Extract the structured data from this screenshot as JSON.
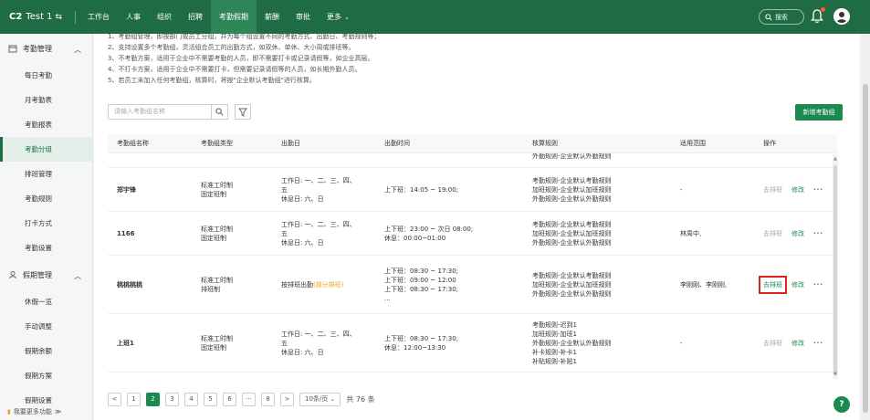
{
  "topbar": {
    "logo": "C2",
    "company": "Test 1",
    "nav": [
      "工作台",
      "人事",
      "组织",
      "招聘",
      "考勤假期",
      "薪酬",
      "审批",
      "更多"
    ],
    "search_placeholder": "搜索"
  },
  "sidebar": {
    "groups": [
      {
        "label": "考勤管理",
        "items": [
          "每日考勤",
          "月考勤表",
          "考勤报表",
          "考勤分组",
          "排班管理",
          "考勤规则",
          "打卡方式",
          "考勤设置"
        ]
      },
      {
        "label": "假期管理",
        "items": [
          "休假一览",
          "手动调整",
          "假期余额",
          "假期方案",
          "假期设置"
        ]
      }
    ],
    "active_item": "考勤分组",
    "footer": "我要更多功能"
  },
  "notes": [
    "1、考勤组管理，即按部门或员工分组，并为每个组设置不同的考勤方式、出勤日、考勤规则等；",
    "2、支持设置多个考勤组，灵活组合员工的出勤方式，如双休、单休、大小周或排班等。",
    "3、不考勤方案，适用于企业中不需要考勤的人员，即不需要打卡或记录请假等，如企业高层。",
    "4、不打卡方案，适用于企业中不需要打卡，但需要记录请假等的人员，如长期外勤人员。",
    "5、若员工未加入任何考勤组，核算时，将按\"企业默认考勤组\"进行核算。"
  ],
  "toolbar": {
    "search_placeholder": "请输入考勤组名称",
    "add_button": "新增考勤组"
  },
  "table": {
    "headers": [
      "考勤组名称",
      "考勤组类型",
      "出勤日",
      "出勤时间",
      "核算规则",
      "适用范围",
      "操作"
    ],
    "partial_row_rule": "外勤规则-企业默认外勤规则",
    "rows": [
      {
        "name": "郑宇锋",
        "type": [
          "标准工时制",
          "固定班制"
        ],
        "days": [
          "工作日: 一、二、三、四、",
          "五",
          "休息日: 六、日"
        ],
        "time": [
          "上下班：14:05 ~ 19:00;"
        ],
        "rules": [
          "考勤规则-企业默认考勤规则",
          "加班规则-企业默认加班规则",
          "外勤规则-企业默认外勤规则"
        ],
        "scope": "-",
        "op_schedule": "去排班",
        "op_edit": "修改",
        "schedule_disabled": true
      },
      {
        "name": "1166",
        "type": [
          "标准工时制",
          "固定班制"
        ],
        "days": [
          "工作日: 一、二、三、四、",
          "五",
          "休息日: 六、日"
        ],
        "time": [
          "上下班：23:00 ~ 次日 08:00;",
          "休息：00:00~01:00"
        ],
        "rules": [
          "考勤规则-企业默认考勤规则",
          "加班规则-企业默认加班规则",
          "外勤规则-企业默认外勤规则"
        ],
        "scope": "林周中,",
        "op_schedule": "去排班",
        "op_edit": "修改",
        "schedule_disabled": true
      },
      {
        "name": "桃桃桃桃",
        "type": [
          "标准工时制",
          "排班制"
        ],
        "days_prefix": "按排班出勤",
        "days_badge": "(部分排班)",
        "time": [
          "上下班：08:30 ~ 17:30;",
          "上下班：09:00 ~ 12:00",
          "上下班：08:30 ~ 17:30;",
          "..."
        ],
        "rules": [
          "考勤规则-企业默认考勤规则",
          "加班规则-企业默认加班规则",
          "外勤规则-企业默认外勤规则"
        ],
        "scope": "李刚刚、李刚刚,",
        "op_schedule": "去排班",
        "op_edit": "修改",
        "schedule_disabled": false
      },
      {
        "name": "上班1",
        "type": [
          "标准工时制",
          "固定班制"
        ],
        "days": [
          "工作日: 一、二、三、四、",
          "五",
          "休息日: 六、日"
        ],
        "time": [
          "上下班：08:30 ~ 17:30;",
          "休息：12:00~13:30"
        ],
        "rules": [
          "考勤规则-迟到1",
          "加班规则-加班1",
          "外勤规则-企业默认外勤规则",
          "补卡规则-补卡1",
          "补贴规则-补贴1"
        ],
        "scope": "-",
        "op_schedule": "去排班",
        "op_edit": "修改",
        "schedule_disabled": true
      }
    ]
  },
  "pagination": {
    "prev": "<",
    "pages": [
      "1",
      "2",
      "3",
      "4",
      "5",
      "6",
      "···",
      "8"
    ],
    "active": "2",
    "next": ">",
    "page_size": "10条/页",
    "total": "共 76 条"
  },
  "colors": {
    "brand": "#1f6b44",
    "accent": "#1a8a4f",
    "highlight_box": "#e0241b",
    "badge": "#f0a020"
  }
}
